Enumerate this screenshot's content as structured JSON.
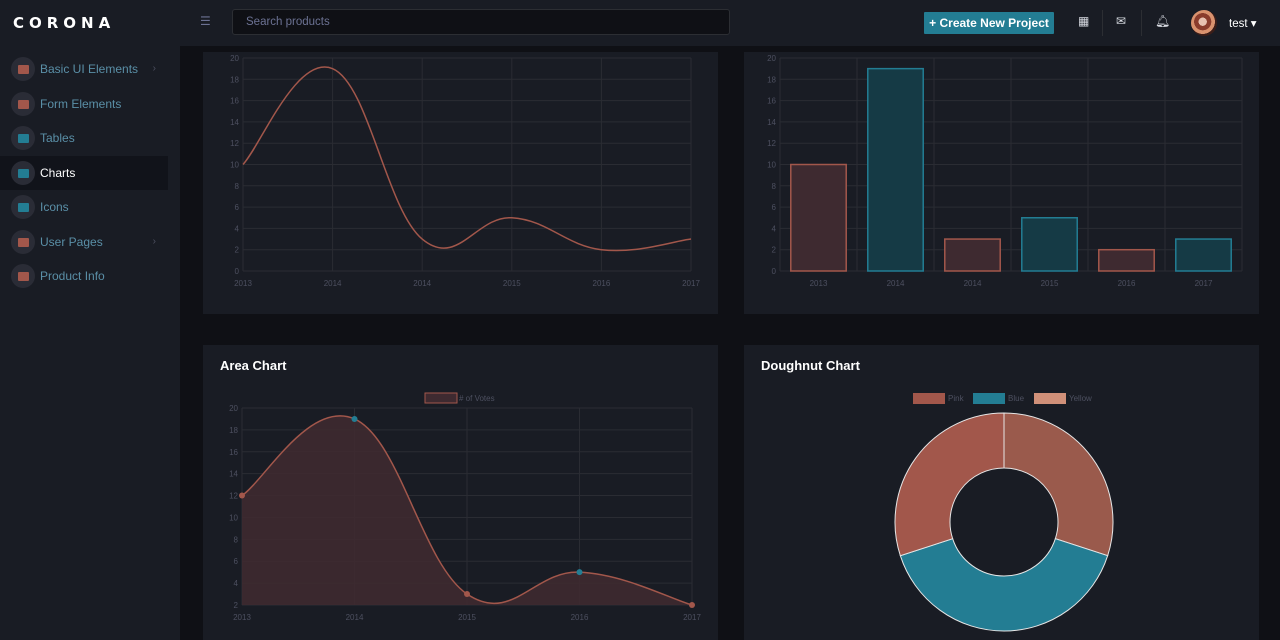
{
  "brand": "CORONA",
  "sidebar": {
    "items": [
      {
        "label": "Basic UI Elements",
        "icon": "laptop-icon",
        "chevron": "›",
        "color": "#a2574b"
      },
      {
        "label": "Form Elements",
        "icon": "form-icon",
        "chevron": "",
        "color": "#a2574b"
      },
      {
        "label": "Tables",
        "icon": "table-icon",
        "chevron": "",
        "color": "#237d93"
      },
      {
        "label": "Charts",
        "icon": "bar-chart-icon",
        "chevron": "",
        "color": "#237d93"
      },
      {
        "label": "Icons",
        "icon": "contacts-icon",
        "chevron": "",
        "color": "#237d93"
      },
      {
        "label": "User Pages",
        "icon": "shield-icon",
        "chevron": "›",
        "color": "#a2574b"
      },
      {
        "label": "Product Info",
        "icon": "box-icon",
        "chevron": "",
        "color": "#a2574b"
      }
    ],
    "active": "Charts"
  },
  "topbar": {
    "search_placeholder": "Search products",
    "create_label": "+ Create New Project",
    "user_name": "test ▾"
  },
  "colors": {
    "pink": "#a2574b",
    "pink_fill": "#3e2a30",
    "blue": "#237d93",
    "blue_fill": "#153a45",
    "yellow": "#d09079",
    "grid": "#2a2c33",
    "tick": "#4d5060"
  },
  "chart_data": [
    {
      "type": "line",
      "x": [
        "2013",
        "2014",
        "2014",
        "2015",
        "2016",
        "2017"
      ],
      "values": [
        10,
        19,
        3,
        5,
        2,
        3
      ],
      "ylim": [
        0,
        20
      ],
      "yticks": [
        0,
        2,
        4,
        6,
        8,
        10,
        12,
        14,
        16,
        18,
        20
      ],
      "title": ""
    },
    {
      "type": "bar",
      "categories": [
        "2013",
        "2014",
        "2014",
        "2015",
        "2016",
        "2017"
      ],
      "values": [
        10,
        19,
        3,
        5,
        2,
        3
      ],
      "ylim": [
        0,
        20
      ],
      "yticks": [
        0,
        2,
        4,
        6,
        8,
        10,
        12,
        14,
        16,
        18,
        20
      ],
      "title": ""
    },
    {
      "type": "area",
      "title": "Area Chart",
      "legend": "# of Votes",
      "x": [
        "2013",
        "2014",
        "2015",
        "2016",
        "2017"
      ],
      "values": [
        12,
        19,
        3,
        5,
        2
      ],
      "ylim": [
        2,
        20
      ],
      "yticks": [
        2,
        4,
        6,
        8,
        10,
        12,
        14,
        16,
        18,
        20
      ]
    },
    {
      "type": "pie",
      "title": "Doughnut Chart",
      "labels": [
        "Pink",
        "Blue",
        "Yellow"
      ],
      "values": [
        30,
        40,
        30
      ]
    }
  ]
}
